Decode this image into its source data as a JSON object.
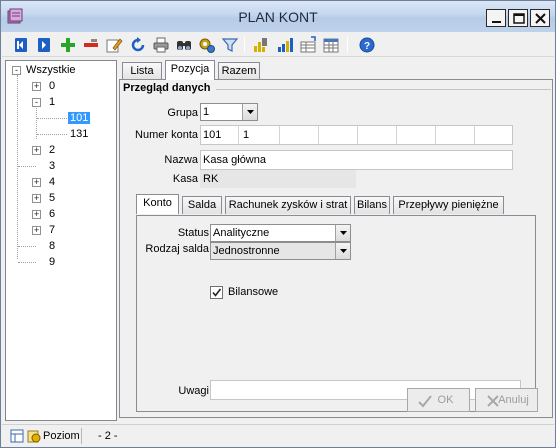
{
  "window": {
    "title": "PLAN KONT"
  },
  "toolbar": {
    "icons": [
      "first-record-icon",
      "previous-record-icon",
      "add-record-icon",
      "delete-record-icon",
      "edit-record-icon",
      "refresh-icon",
      "print-icon",
      "find-icon",
      "settings-icon",
      "filter-icon",
      "report-icon",
      "chart-icon",
      "table-icon",
      "table-grid-icon",
      "help-icon"
    ]
  },
  "tree": {
    "root": "Wszystkie",
    "items": [
      {
        "label": "0",
        "toggle": "+"
      },
      {
        "label": "1",
        "toggle": "-"
      },
      {
        "label": "101",
        "toggle": ""
      },
      {
        "label": "131",
        "toggle": ""
      },
      {
        "label": "2",
        "toggle": "+"
      },
      {
        "label": "3",
        "toggle": ""
      },
      {
        "label": "4",
        "toggle": "+"
      },
      {
        "label": "5",
        "toggle": "+"
      },
      {
        "label": "6",
        "toggle": "+"
      },
      {
        "label": "7",
        "toggle": "+"
      },
      {
        "label": "8",
        "toggle": ""
      },
      {
        "label": "9",
        "toggle": ""
      }
    ]
  },
  "tabs": [
    "Lista",
    "Pozycja",
    "Razem"
  ],
  "overview": {
    "title": "Przegląd danych",
    "grupa_label": "Grupa",
    "grupa_value": "1",
    "numer_label": "Numer konta",
    "numer_parts": [
      "101",
      "1"
    ],
    "nazwa_label": "Nazwa",
    "nazwa_value": "Kasa główna",
    "kasa_label": "Kasa",
    "kasa_value": "RK"
  },
  "subtabs": [
    "Konto",
    "Salda",
    "Rachunek zysków i strat",
    "Bilans",
    "Przepływy pieniężne"
  ],
  "konto": {
    "status_label": "Status",
    "status_value": "Analityczne",
    "rodzaj_label": "Rodzaj salda",
    "rodzaj_value": "Jednostronne",
    "bilansowe_label": "Bilansowe",
    "bilansowe_checked": true,
    "uwagi_label": "Uwagi",
    "uwagi_value": ""
  },
  "buttons": {
    "ok": "OK",
    "cancel": "Anuluj"
  },
  "statusbar": {
    "poziom_label": "Poziom",
    "poziom_value": "- 2 -"
  }
}
